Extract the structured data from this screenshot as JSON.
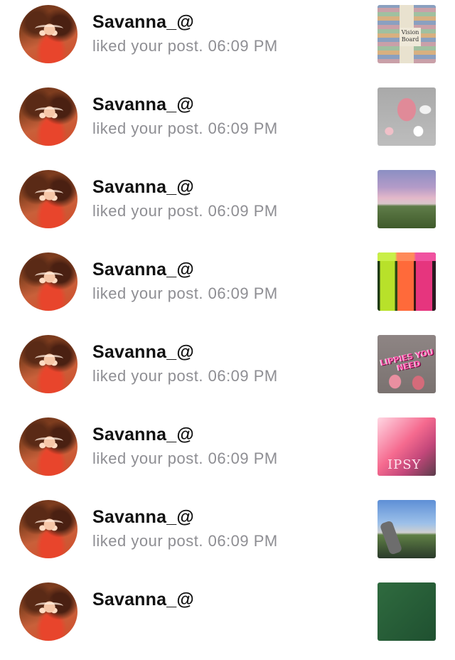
{
  "notifications": [
    {
      "username": "Savanna_@",
      "action": "liked your post.",
      "time": "06:09 PM",
      "thumb_text": "Vision Board"
    },
    {
      "username": "Savanna_@",
      "action": "liked your post.",
      "time": "06:09 PM",
      "thumb_text": ""
    },
    {
      "username": "Savanna_@",
      "action": "liked your post.",
      "time": "06:09 PM",
      "thumb_text": ""
    },
    {
      "username": "Savanna_@",
      "action": "liked your post.",
      "time": "06:09 PM",
      "thumb_text": ""
    },
    {
      "username": "Savanna_@",
      "action": "liked your post.",
      "time": "06:09 PM",
      "thumb_text": "LIPPIES YOU NEED"
    },
    {
      "username": "Savanna_@",
      "action": "liked your post.",
      "time": "06:09 PM",
      "thumb_text": "IPSY"
    },
    {
      "username": "Savanna_@",
      "action": "liked your post.",
      "time": "06:09 PM",
      "thumb_text": ""
    },
    {
      "username": "Savanna_@",
      "action": "",
      "time": "",
      "thumb_text": ""
    }
  ],
  "colors": {
    "username": "#111111",
    "secondary_text": "#8e8e93",
    "background": "#ffffff"
  }
}
